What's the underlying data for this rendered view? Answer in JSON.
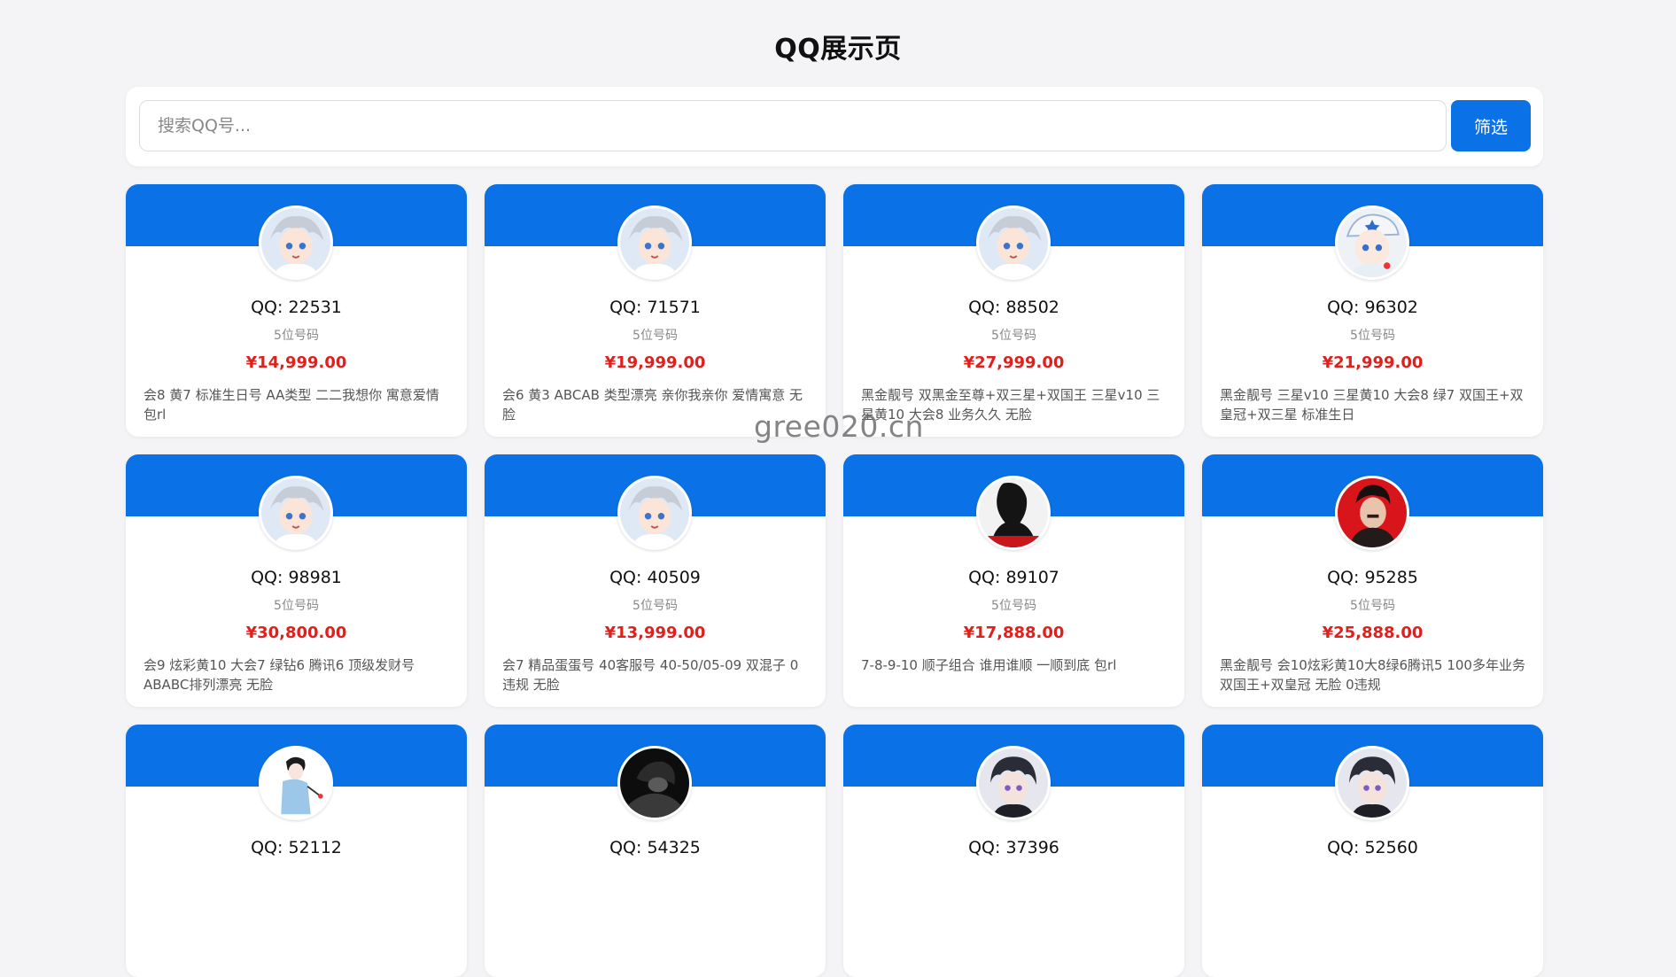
{
  "page": {
    "title": "QQ展示页",
    "watermark": "gree020.cn"
  },
  "search": {
    "placeholder": "搜索QQ号...",
    "value": "",
    "button_label": "筛选"
  },
  "colors": {
    "accent": "#0a72e6",
    "price": "#e0201c",
    "background": "#f4f4f6"
  },
  "cards": [
    {
      "qq": "QQ: 22531",
      "digits": "5位号码",
      "price": "¥14,999.00",
      "desc": "会8 黄7 标准生日号 AA类型 二二我想你 寓意爱情 包rl",
      "avatar": "anime-silver-boy"
    },
    {
      "qq": "QQ: 71571",
      "digits": "5位号码",
      "price": "¥19,999.00",
      "desc": "会6 黄3 ABCAB 类型漂亮 亲你我亲你 爱情寓意 无脸",
      "avatar": "anime-silver-boy"
    },
    {
      "qq": "QQ: 88502",
      "digits": "5位号码",
      "price": "¥27,999.00",
      "desc": "黑金靓号 双黑金至尊+双三星+双国王 三星v10 三星黄10 大会8 业务久久 无脸",
      "avatar": "anime-silver-boy"
    },
    {
      "qq": "QQ: 96302",
      "digits": "5位号码",
      "price": "¥21,999.00",
      "desc": "黑金靓号 三星v10 三星黄10 大会8 绿7 双国王+双皇冠+双三星 标准生日",
      "avatar": "anime-white-hat-boy"
    },
    {
      "qq": "QQ: 98981",
      "digits": "5位号码",
      "price": "¥30,800.00",
      "desc": "会9 炫彩黄10 大会7 绿钻6 腾讯6 顶级发财号 ABABC排列漂亮 无脸",
      "avatar": "anime-silver-boy"
    },
    {
      "qq": "QQ: 40509",
      "digits": "5位号码",
      "price": "¥13,999.00",
      "desc": "会7 精品蛋蛋号 40客服号 40-50/05-09 双混子 0违规 无脸",
      "avatar": "anime-silver-boy"
    },
    {
      "qq": "QQ: 89107",
      "digits": "5位号码",
      "price": "¥17,888.00",
      "desc": "7-8-9-10 顺子组合 谁用谁顺 一顺到底 包rl",
      "avatar": "dark-silhouette"
    },
    {
      "qq": "QQ: 95285",
      "digits": "5位号码",
      "price": "¥25,888.00",
      "desc": "黑金靓号 会10炫彩黄10大8绿6腾讯5 100多年业务 双国王+双皇冠 无脸 0违规",
      "avatar": "red-dark-man"
    },
    {
      "qq": "QQ: 52112",
      "digits": "",
      "price": "",
      "desc": "",
      "avatar": "sketch-boy"
    },
    {
      "qq": "QQ: 54325",
      "digits": "",
      "price": "",
      "desc": "",
      "avatar": "dark-photo"
    },
    {
      "qq": "QQ: 37396",
      "digits": "",
      "price": "",
      "desc": "",
      "avatar": "anime-dark-hair"
    },
    {
      "qq": "QQ: 52560",
      "digits": "",
      "price": "",
      "desc": "",
      "avatar": "anime-dark-hair"
    }
  ]
}
